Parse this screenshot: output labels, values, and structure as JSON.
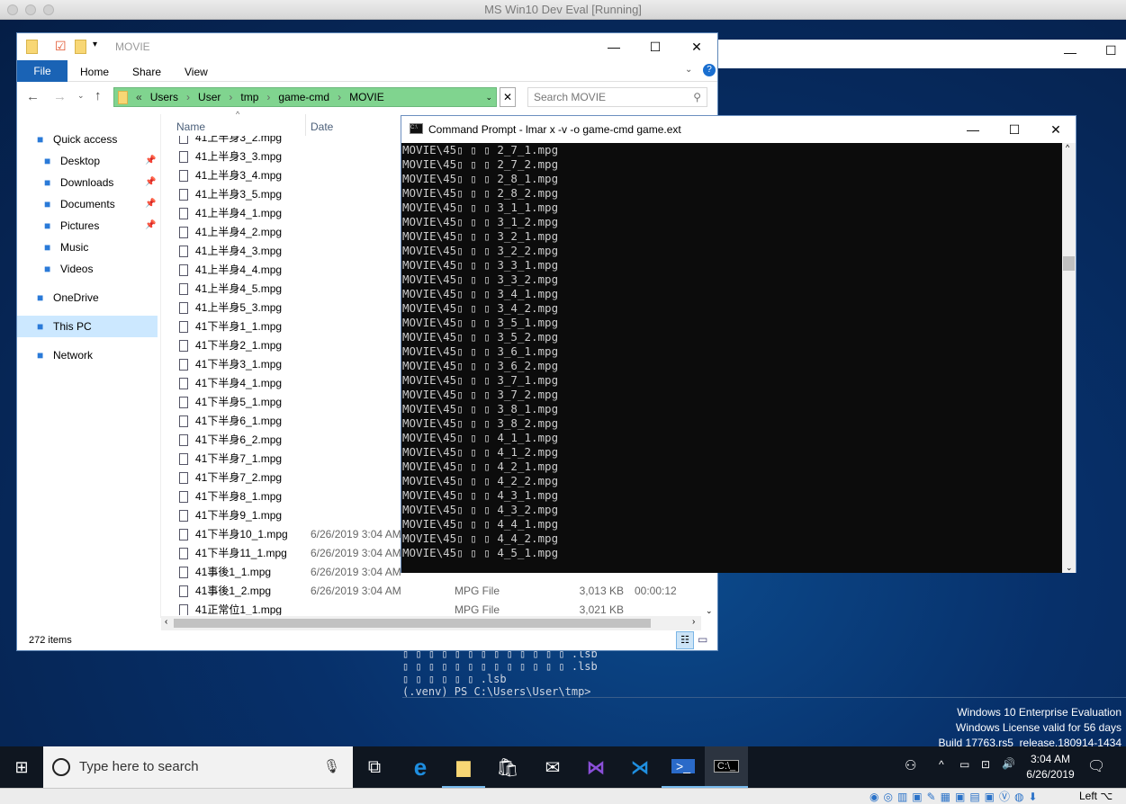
{
  "host": {
    "title": "MS Win10 Dev Eval [Running]"
  },
  "explorer": {
    "title": "MOVIE",
    "ribbon_tabs": [
      "File",
      "Home",
      "Share",
      "View"
    ],
    "breadcrumb": [
      "Users",
      "User",
      "tmp",
      "game-cmd",
      "MOVIE"
    ],
    "search_placeholder": "Search MOVIE",
    "columns": {
      "name": "Name",
      "date": "Date"
    },
    "nav": [
      {
        "label": "Quick access",
        "icon": "star-icon"
      },
      {
        "label": "Desktop",
        "icon": "desktop-icon",
        "pinned": true
      },
      {
        "label": "Downloads",
        "icon": "download-icon",
        "pinned": true
      },
      {
        "label": "Documents",
        "icon": "documents-icon",
        "pinned": true
      },
      {
        "label": "Pictures",
        "icon": "pictures-icon",
        "pinned": true
      },
      {
        "label": "Music",
        "icon": "music-icon"
      },
      {
        "label": "Videos",
        "icon": "videos-icon"
      },
      {
        "label": "OneDrive",
        "icon": "cloud-icon"
      },
      {
        "label": "This PC",
        "icon": "pc-icon",
        "selected": true
      },
      {
        "label": "Network",
        "icon": "network-icon"
      }
    ],
    "files": [
      {
        "name": "41上半身3_2.mpg",
        "date": "",
        "type": "",
        "size": "",
        "length": ""
      },
      {
        "name": "41上半身3_3.mpg",
        "date": "",
        "type": "",
        "size": "",
        "length": ""
      },
      {
        "name": "41上半身3_4.mpg",
        "date": "",
        "type": "",
        "size": "",
        "length": ""
      },
      {
        "name": "41上半身3_5.mpg",
        "date": "",
        "type": "",
        "size": "",
        "length": ""
      },
      {
        "name": "41上半身4_1.mpg",
        "date": "",
        "type": "",
        "size": "",
        "length": ""
      },
      {
        "name": "41上半身4_2.mpg",
        "date": "",
        "type": "",
        "size": "",
        "length": ""
      },
      {
        "name": "41上半身4_3.mpg",
        "date": "",
        "type": "",
        "size": "",
        "length": ""
      },
      {
        "name": "41上半身4_4.mpg",
        "date": "",
        "type": "",
        "size": "",
        "length": ""
      },
      {
        "name": "41上半身4_5.mpg",
        "date": "",
        "type": "",
        "size": "",
        "length": ""
      },
      {
        "name": "41上半身5_3.mpg",
        "date": "",
        "type": "",
        "size": "",
        "length": ""
      },
      {
        "name": "41下半身1_1.mpg",
        "date": "",
        "type": "",
        "size": "",
        "length": ""
      },
      {
        "name": "41下半身2_1.mpg",
        "date": "",
        "type": "",
        "size": "",
        "length": ""
      },
      {
        "name": "41下半身3_1.mpg",
        "date": "",
        "type": "",
        "size": "",
        "length": ""
      },
      {
        "name": "41下半身4_1.mpg",
        "date": "",
        "type": "",
        "size": "",
        "length": ""
      },
      {
        "name": "41下半身5_1.mpg",
        "date": "",
        "type": "",
        "size": "",
        "length": ""
      },
      {
        "name": "41下半身6_1.mpg",
        "date": "",
        "type": "",
        "size": "",
        "length": ""
      },
      {
        "name": "41下半身6_2.mpg",
        "date": "",
        "type": "",
        "size": "",
        "length": ""
      },
      {
        "name": "41下半身7_1.mpg",
        "date": "",
        "type": "",
        "size": "",
        "length": ""
      },
      {
        "name": "41下半身7_2.mpg",
        "date": "",
        "type": "",
        "size": "",
        "length": ""
      },
      {
        "name": "41下半身8_1.mpg",
        "date": "",
        "type": "",
        "size": "",
        "length": ""
      },
      {
        "name": "41下半身9_1.mpg",
        "date": "",
        "type": "",
        "size": "",
        "length": ""
      },
      {
        "name": "41下半身10_1.mpg",
        "date": "6/26/2019 3:04 AM",
        "type": "",
        "size": "",
        "length": ""
      },
      {
        "name": "41下半身11_1.mpg",
        "date": "6/26/2019 3:04 AM",
        "type": "",
        "size": "",
        "length": ""
      },
      {
        "name": "41事後1_1.mpg",
        "date": "6/26/2019 3:04 AM",
        "type": "",
        "size": "",
        "length": ""
      },
      {
        "name": "41事後1_2.mpg",
        "date": "6/26/2019 3:04 AM",
        "type": "MPG File",
        "size": "3,013 KB",
        "length": "00:00:12"
      },
      {
        "name": "41正常位1_1.mpg",
        "date": "",
        "type": "MPG File",
        "size": "3,021 KB",
        "length": ""
      }
    ],
    "status": "272 items"
  },
  "cmd": {
    "title": "Command Prompt - lmar  x -v -o game-cmd game.ext",
    "lines": [
      "MOVIE\\45▯ ▯ ▯ 2_7_1.mpg",
      "MOVIE\\45▯ ▯ ▯ 2_7_2.mpg",
      "MOVIE\\45▯ ▯ ▯ 2_8_1.mpg",
      "MOVIE\\45▯ ▯ ▯ 2_8_2.mpg",
      "MOVIE\\45▯ ▯ ▯ 3_1_1.mpg",
      "MOVIE\\45▯ ▯ ▯ 3_1_2.mpg",
      "MOVIE\\45▯ ▯ ▯ 3_2_1.mpg",
      "MOVIE\\45▯ ▯ ▯ 3_2_2.mpg",
      "MOVIE\\45▯ ▯ ▯ 3_3_1.mpg",
      "MOVIE\\45▯ ▯ ▯ 3_3_2.mpg",
      "MOVIE\\45▯ ▯ ▯ 3_4_1.mpg",
      "MOVIE\\45▯ ▯ ▯ 3_4_2.mpg",
      "MOVIE\\45▯ ▯ ▯ 3_5_1.mpg",
      "MOVIE\\45▯ ▯ ▯ 3_5_2.mpg",
      "MOVIE\\45▯ ▯ ▯ 3_6_1.mpg",
      "MOVIE\\45▯ ▯ ▯ 3_6_2.mpg",
      "MOVIE\\45▯ ▯ ▯ 3_7_1.mpg",
      "MOVIE\\45▯ ▯ ▯ 3_7_2.mpg",
      "MOVIE\\45▯ ▯ ▯ 3_8_1.mpg",
      "MOVIE\\45▯ ▯ ▯ 3_8_2.mpg",
      "MOVIE\\45▯ ▯ ▯ 4_1_1.mpg",
      "MOVIE\\45▯ ▯ ▯ 4_1_2.mpg",
      "MOVIE\\45▯ ▯ ▯ 4_2_1.mpg",
      "MOVIE\\45▯ ▯ ▯ 4_2_2.mpg",
      "MOVIE\\45▯ ▯ ▯ 4_3_1.mpg",
      "MOVIE\\45▯ ▯ ▯ 4_3_2.mpg",
      "MOVIE\\45▯ ▯ ▯ 4_4_1.mpg",
      "MOVIE\\45▯ ▯ ▯ 4_4_2.mpg",
      "MOVIE\\45▯ ▯ ▯ 4_5_1.mpg"
    ]
  },
  "powershell": {
    "lines": [
      "▯ ▯ ▯ ▯ ▯ ▯ ▯ ▯ ▯ ▯ ▯ ▯ ▯ .lsb",
      "▯ ▯ ▯ ▯ ▯ ▯ ▯ ▯ ▯ ▯ ▯ ▯ ▯ .lsb",
      "▯ ▯ ▯ ▯ ▯ ▯ .lsb",
      "(.venv) PS C:\\Users\\User\\tmp>"
    ]
  },
  "watermark": [
    "Windows 10 Enterprise Evaluation",
    "Windows License valid for 56 days",
    "Build 17763.rs5_release.180914-1434"
  ],
  "taskbar": {
    "search_placeholder": "Type here to search",
    "time": "3:04 AM",
    "date": "6/26/2019"
  },
  "vbox": {
    "host_key": "Left ⌥"
  },
  "colors": {
    "accent": "#0063b1",
    "breadcrumb_bg": "#80d48f",
    "cmd_text": "#cccccc",
    "desktop": "#0a2450"
  }
}
